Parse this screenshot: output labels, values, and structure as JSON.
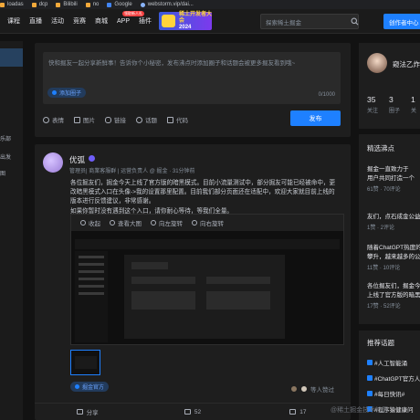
{
  "bookmarks": [
    "loadas",
    "dcp",
    "Bilibili",
    "no",
    "Google",
    "webstorm.vip/dai..."
  ],
  "nav": {
    "items": [
      "课程",
      "直播",
      "活动",
      "竞赛",
      "商城",
      "APP",
      "插件"
    ],
    "app_badge": "领取新人礼",
    "promo_title": "稀土开发者大会",
    "promo_sub": "2024",
    "search_placeholder": "探索稀土掘金",
    "create_label": "创作者中心"
  },
  "leftbar": {
    "labels": [
      "乐部",
      "出发",
      "图"
    ]
  },
  "composer": {
    "placeholder": "快和掘友一起分享新鲜事！告诉你个小秘密，发布沸点时添加圈子和话题会被更多掘友看到哦~",
    "circle_tag": "添加圈子",
    "counter": "0/1000",
    "tools": [
      "表情",
      "图片",
      "链接",
      "话题",
      "代码"
    ],
    "publish_label": "发布"
  },
  "post": {
    "author": "优弧",
    "meta": "管理员| 商業客服群 | 运营负责人 @ 掘金 · 31分钟前",
    "body_line1": "各位掘友们，掘金今天上线了官方版的暗黑模式。目前小流量测试中，部分掘友可能已经被命中，更",
    "body_line2": "改暗黑模式入口在头像->我的设置那里配置。目前我们部分页面还在适配中，欢迎大家就目前上线的",
    "body_line3": "版本进行反馈建议，非常感谢。",
    "body_line4": "如果你暂时没有遇到这个入口，请你耐心等待，等我们全量。",
    "viewer_toolbar": [
      "收起",
      "查看大图",
      "向左旋转",
      "向右旋转"
    ],
    "circle_tag": "掘金官方",
    "likers_text": "等人赞过",
    "actions": [
      {
        "name": "share",
        "label": "分享"
      },
      {
        "name": "comment",
        "label": "52"
      },
      {
        "name": "like",
        "label": "17"
      }
    ]
  },
  "profile": {
    "name": "窥法乙炸",
    "stats": [
      {
        "num": "35",
        "label": "关注"
      },
      {
        "num": "3",
        "label": "圈子"
      },
      {
        "num": "1",
        "label": "关"
      }
    ]
  },
  "hot": {
    "title": "精选沸点",
    "items": [
      {
        "line1": "掘金一直致力于",
        "line2": "用户共同打造一个",
        "meta": "61赞 · 70评论"
      },
      {
        "line1": "友们，点石成金公益",
        "line2": "",
        "meta": "1赞 · 2评论"
      },
      {
        "line1": "随着ChatGPT热度的",
        "line2": "攀升，越来越多的公",
        "meta": "11赞 · 10评论"
      },
      {
        "line1": "各位掘友们，掘金今",
        "line2": "上线了官方版的暗黑",
        "meta": "17赞 · 52评论"
      }
    ]
  },
  "topics": {
    "title": "推荐话题",
    "items": [
      "#人工智能涌",
      "#ChatGPT官方人",
      "#每日快讯#",
      "#程序猿健康问"
    ]
  },
  "watermark": "@稀土掘金技术社区",
  "colors": {
    "accent": "#1e80ff",
    "bg": "#121212",
    "card": "#1e1e1e"
  }
}
